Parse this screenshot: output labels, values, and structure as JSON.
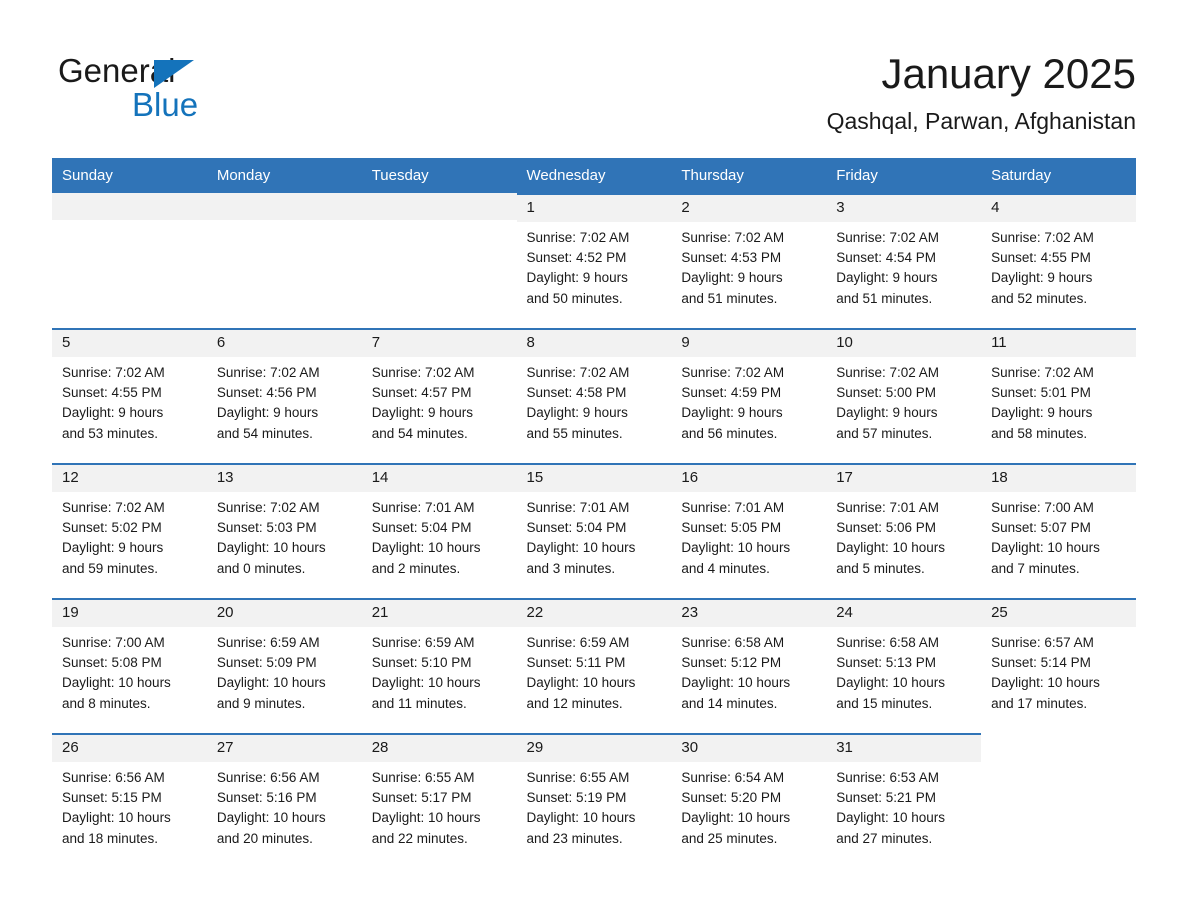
{
  "brand": {
    "word_one": "General",
    "word_two": "Blue",
    "triangle_icon": "brand-triangle-icon"
  },
  "header": {
    "month_title": "January 2025",
    "location": "Qashqal, Parwan, Afghanistan"
  },
  "colors": {
    "header_blue": "#3074b7",
    "brand_blue": "#1473bb",
    "day_band_gray": "#f2f2f2",
    "text": "#1a1a1a"
  },
  "calendar": {
    "weekday_headers": [
      "Sunday",
      "Monday",
      "Tuesday",
      "Wednesday",
      "Thursday",
      "Friday",
      "Saturday"
    ],
    "weeks": [
      [
        {
          "blank": true
        },
        {
          "blank": true
        },
        {
          "blank": true
        },
        {
          "day": "1",
          "sunrise": "Sunrise: 7:02 AM",
          "sunset": "Sunset: 4:52 PM",
          "daylight_1": "Daylight: 9 hours",
          "daylight_2": "and 50 minutes."
        },
        {
          "day": "2",
          "sunrise": "Sunrise: 7:02 AM",
          "sunset": "Sunset: 4:53 PM",
          "daylight_1": "Daylight: 9 hours",
          "daylight_2": "and 51 minutes."
        },
        {
          "day": "3",
          "sunrise": "Sunrise: 7:02 AM",
          "sunset": "Sunset: 4:54 PM",
          "daylight_1": "Daylight: 9 hours",
          "daylight_2": "and 51 minutes."
        },
        {
          "day": "4",
          "sunrise": "Sunrise: 7:02 AM",
          "sunset": "Sunset: 4:55 PM",
          "daylight_1": "Daylight: 9 hours",
          "daylight_2": "and 52 minutes."
        }
      ],
      [
        {
          "day": "5",
          "sunrise": "Sunrise: 7:02 AM",
          "sunset": "Sunset: 4:55 PM",
          "daylight_1": "Daylight: 9 hours",
          "daylight_2": "and 53 minutes."
        },
        {
          "day": "6",
          "sunrise": "Sunrise: 7:02 AM",
          "sunset": "Sunset: 4:56 PM",
          "daylight_1": "Daylight: 9 hours",
          "daylight_2": "and 54 minutes."
        },
        {
          "day": "7",
          "sunrise": "Sunrise: 7:02 AM",
          "sunset": "Sunset: 4:57 PM",
          "daylight_1": "Daylight: 9 hours",
          "daylight_2": "and 54 minutes."
        },
        {
          "day": "8",
          "sunrise": "Sunrise: 7:02 AM",
          "sunset": "Sunset: 4:58 PM",
          "daylight_1": "Daylight: 9 hours",
          "daylight_2": "and 55 minutes."
        },
        {
          "day": "9",
          "sunrise": "Sunrise: 7:02 AM",
          "sunset": "Sunset: 4:59 PM",
          "daylight_1": "Daylight: 9 hours",
          "daylight_2": "and 56 minutes."
        },
        {
          "day": "10",
          "sunrise": "Sunrise: 7:02 AM",
          "sunset": "Sunset: 5:00 PM",
          "daylight_1": "Daylight: 9 hours",
          "daylight_2": "and 57 minutes."
        },
        {
          "day": "11",
          "sunrise": "Sunrise: 7:02 AM",
          "sunset": "Sunset: 5:01 PM",
          "daylight_1": "Daylight: 9 hours",
          "daylight_2": "and 58 minutes."
        }
      ],
      [
        {
          "day": "12",
          "sunrise": "Sunrise: 7:02 AM",
          "sunset": "Sunset: 5:02 PM",
          "daylight_1": "Daylight: 9 hours",
          "daylight_2": "and 59 minutes."
        },
        {
          "day": "13",
          "sunrise": "Sunrise: 7:02 AM",
          "sunset": "Sunset: 5:03 PM",
          "daylight_1": "Daylight: 10 hours",
          "daylight_2": "and 0 minutes."
        },
        {
          "day": "14",
          "sunrise": "Sunrise: 7:01 AM",
          "sunset": "Sunset: 5:04 PM",
          "daylight_1": "Daylight: 10 hours",
          "daylight_2": "and 2 minutes."
        },
        {
          "day": "15",
          "sunrise": "Sunrise: 7:01 AM",
          "sunset": "Sunset: 5:04 PM",
          "daylight_1": "Daylight: 10 hours",
          "daylight_2": "and 3 minutes."
        },
        {
          "day": "16",
          "sunrise": "Sunrise: 7:01 AM",
          "sunset": "Sunset: 5:05 PM",
          "daylight_1": "Daylight: 10 hours",
          "daylight_2": "and 4 minutes."
        },
        {
          "day": "17",
          "sunrise": "Sunrise: 7:01 AM",
          "sunset": "Sunset: 5:06 PM",
          "daylight_1": "Daylight: 10 hours",
          "daylight_2": "and 5 minutes."
        },
        {
          "day": "18",
          "sunrise": "Sunrise: 7:00 AM",
          "sunset": "Sunset: 5:07 PM",
          "daylight_1": "Daylight: 10 hours",
          "daylight_2": "and 7 minutes."
        }
      ],
      [
        {
          "day": "19",
          "sunrise": "Sunrise: 7:00 AM",
          "sunset": "Sunset: 5:08 PM",
          "daylight_1": "Daylight: 10 hours",
          "daylight_2": "and 8 minutes."
        },
        {
          "day": "20",
          "sunrise": "Sunrise: 6:59 AM",
          "sunset": "Sunset: 5:09 PM",
          "daylight_1": "Daylight: 10 hours",
          "daylight_2": "and 9 minutes."
        },
        {
          "day": "21",
          "sunrise": "Sunrise: 6:59 AM",
          "sunset": "Sunset: 5:10 PM",
          "daylight_1": "Daylight: 10 hours",
          "daylight_2": "and 11 minutes."
        },
        {
          "day": "22",
          "sunrise": "Sunrise: 6:59 AM",
          "sunset": "Sunset: 5:11 PM",
          "daylight_1": "Daylight: 10 hours",
          "daylight_2": "and 12 minutes."
        },
        {
          "day": "23",
          "sunrise": "Sunrise: 6:58 AM",
          "sunset": "Sunset: 5:12 PM",
          "daylight_1": "Daylight: 10 hours",
          "daylight_2": "and 14 minutes."
        },
        {
          "day": "24",
          "sunrise": "Sunrise: 6:58 AM",
          "sunset": "Sunset: 5:13 PM",
          "daylight_1": "Daylight: 10 hours",
          "daylight_2": "and 15 minutes."
        },
        {
          "day": "25",
          "sunrise": "Sunrise: 6:57 AM",
          "sunset": "Sunset: 5:14 PM",
          "daylight_1": "Daylight: 10 hours",
          "daylight_2": "and 17 minutes."
        }
      ],
      [
        {
          "day": "26",
          "sunrise": "Sunrise: 6:56 AM",
          "sunset": "Sunset: 5:15 PM",
          "daylight_1": "Daylight: 10 hours",
          "daylight_2": "and 18 minutes."
        },
        {
          "day": "27",
          "sunrise": "Sunrise: 6:56 AM",
          "sunset": "Sunset: 5:16 PM",
          "daylight_1": "Daylight: 10 hours",
          "daylight_2": "and 20 minutes."
        },
        {
          "day": "28",
          "sunrise": "Sunrise: 6:55 AM",
          "sunset": "Sunset: 5:17 PM",
          "daylight_1": "Daylight: 10 hours",
          "daylight_2": "and 22 minutes."
        },
        {
          "day": "29",
          "sunrise": "Sunrise: 6:55 AM",
          "sunset": "Sunset: 5:19 PM",
          "daylight_1": "Daylight: 10 hours",
          "daylight_2": "and 23 minutes."
        },
        {
          "day": "30",
          "sunrise": "Sunrise: 6:54 AM",
          "sunset": "Sunset: 5:20 PM",
          "daylight_1": "Daylight: 10 hours",
          "daylight_2": "and 25 minutes."
        },
        {
          "day": "31",
          "sunrise": "Sunrise: 6:53 AM",
          "sunset": "Sunset: 5:21 PM",
          "daylight_1": "Daylight: 10 hours",
          "daylight_2": "and 27 minutes."
        },
        {
          "void": true
        }
      ]
    ]
  }
}
